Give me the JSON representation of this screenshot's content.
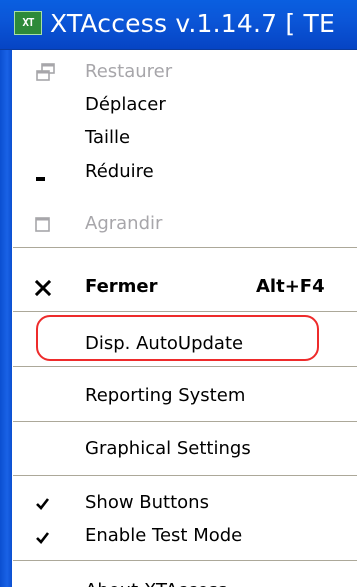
{
  "window": {
    "title": "XTAccess v.1.14.7 [ TE",
    "icon_label": "XT",
    "icon_name": "app-icon"
  },
  "menu": {
    "restore": {
      "label": "Restaurer",
      "icon": "restore-icon",
      "enabled": false
    },
    "move": {
      "label": "Déplacer"
    },
    "size": {
      "label": "Taille"
    },
    "minimize": {
      "label": "Réduire",
      "icon": "minimize-icon"
    },
    "maximize": {
      "label": "Agrandir",
      "icon": "maximize-icon",
      "enabled": false
    },
    "close": {
      "label": "Fermer",
      "shortcut": "Alt+F4",
      "icon": "close-icon"
    },
    "disp_autoupdate": {
      "label": "Disp. AutoUpdate"
    },
    "reporting_system": {
      "label": "Reporting System"
    },
    "graphical_settings": {
      "label": "Graphical Settings"
    },
    "show_buttons": {
      "label": "Show Buttons",
      "checked": true
    },
    "enable_test_mode": {
      "label": "Enable Test Mode",
      "checked": true
    },
    "about": {
      "label": "About XTAccess"
    }
  },
  "annotation": {
    "color": "#ee2b2b"
  },
  "colors": {
    "titlebar": "#0b56d8",
    "disabled_text": "#a7a6aa",
    "separator": "#aca899"
  }
}
